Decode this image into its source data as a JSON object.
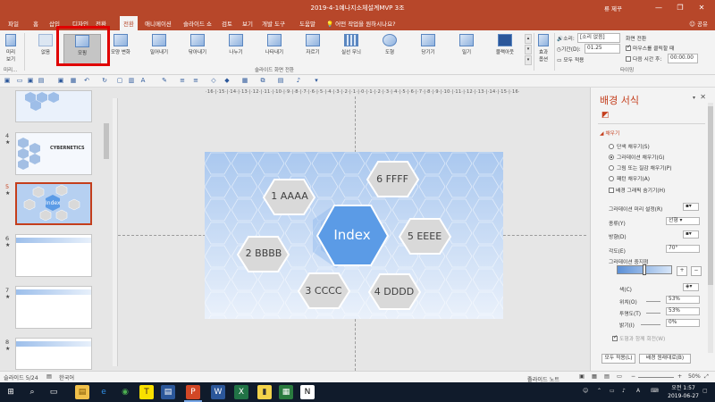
{
  "window": {
    "title": "2019-4-1예나지소체설계MVP 3조",
    "user": "류 제꾸",
    "min_glyph": "—",
    "restore_glyph": "❐",
    "close_glyph": "✕"
  },
  "tabs": {
    "items": [
      "파일",
      "홈",
      "삽입",
      "디자인",
      "전환",
      "애니메이션",
      "슬라이드 쇼",
      "검토",
      "보기",
      "개발 도구",
      "도움말"
    ],
    "active": "전환",
    "tell_me": "어떤 작업을 원하시나요?",
    "share": "공유"
  },
  "ribbon": {
    "preview_label": "미리\n보기",
    "preview_group": "미리...",
    "transitions": [
      "없음",
      "모핑",
      "모양 변화",
      "밀어내기",
      "닦아내기",
      "나누기",
      "나타내기",
      "자르기",
      "실선 무늬",
      "도형",
      "당기기",
      "밀기",
      "블랙아웃"
    ],
    "selected_transition": "모핑",
    "group_label": "슬라이드 화면 전환",
    "effect_options": "효과\n옵션",
    "sound_label": "소리:",
    "sound_value": "[소리 없음]",
    "duration_label": "기간(D):",
    "duration_value": "01.25",
    "apply_all": "모두 적용",
    "advance_label": "화면 전환",
    "on_click": "마우스를 클릭할 때",
    "after_label": "다음 시간 후:",
    "after_value": "00:00.00",
    "timing_group": "타이밍"
  },
  "thumbnails": [
    {
      "num": "",
      "title": ""
    },
    {
      "num": "4",
      "title": "CYBERNETICS"
    },
    {
      "num": "5",
      "title": "Index"
    },
    {
      "num": "6",
      "title": ""
    },
    {
      "num": "7",
      "title": ""
    },
    {
      "num": "8",
      "title": ""
    }
  ],
  "ruler": {
    "ticks": "·16·|·15·|·14·|·13·|·12·|·11·|·10·|·9·|·8·|·7·|·6·|·5·|·4·|·3·|·2·|·1·|·0·|·1·|·2·|·3·|·4·|·5·|·6·|·7·|·8·|·9·|·10·|·11·|·12·|·13·|·14·|·15·|·16·"
  },
  "slide": {
    "center": "Index",
    "items": [
      "1 AAAA",
      "2 BBBB",
      "3 CCCC",
      "4 DDDD",
      "5 EEEE",
      "6 FFFF"
    ]
  },
  "format_pane": {
    "title": "배경 서식",
    "section": "채우기",
    "fill_options": [
      "단색 채우기(S)",
      "그라데이션 채우기(G)",
      "그림 또는 질감 채우기(P)",
      "패턴 채우기(A)"
    ],
    "selected_fill": 1,
    "hide_bg_graphics": "배경 그래픽 숨기기(H)",
    "preset_label": "그라데이션 미리 설정(R)",
    "type_label": "종류(Y)",
    "type_value": "선형",
    "direction_label": "방향(D)",
    "angle_label": "각도(E)",
    "angle_value": "70°",
    "stops_label": "그라데이션 중지점",
    "color_label": "색(C)",
    "position_label": "위치(O)",
    "position_value": "53%",
    "transparency_label": "투명도(T)",
    "transparency_value": "53%",
    "brightness_label": "밝기(I)",
    "brightness_value": "0%",
    "rotate_with_shape": "도형과 함께 회전(W)",
    "apply_all": "모두 적용(L)",
    "reset": "배경 원래대로(B)"
  },
  "status": {
    "slide": "슬라이드 5/24",
    "language": "한국어",
    "notes": "슬라이드 노트",
    "zoom": "50%"
  },
  "taskbar": {
    "time": "오전 1:57",
    "date": "2019-06-27",
    "apps": [
      "⊞",
      "⌕",
      "e",
      "◉",
      "T",
      "▤",
      "P",
      "W",
      "X",
      "▮",
      "N"
    ]
  },
  "colors": {
    "accent": "#b7472a",
    "selection_red": "#e00000",
    "hex_fill": "#d9d9d9",
    "hex_center": "#5b9be6"
  }
}
